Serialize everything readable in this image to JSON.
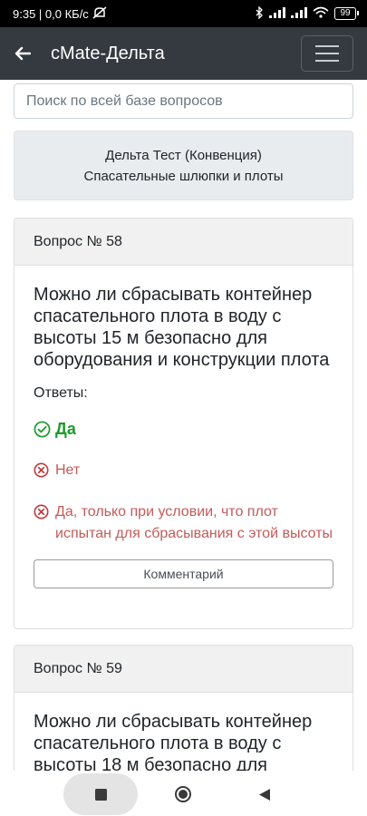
{
  "status_bar": {
    "time_speed": "9:35 | 0,0 КБ/с",
    "battery": "99"
  },
  "app_bar": {
    "title": "cMate-Дельта"
  },
  "search": {
    "placeholder": "Поиск по всей базе вопросов"
  },
  "topic": {
    "line1": "Дельта Тест (Конвенция)",
    "line2": "Спасательные шлюпки и плоты"
  },
  "questions": [
    {
      "header": "Вопрос № 58",
      "text": "Можно ли сбрасывать контейнер спасательного плота в воду с высоты 15 м безопасно для оборудования и конструкции плота",
      "answers_label": "Ответы:",
      "answers": [
        {
          "text": "Да",
          "status": "correct"
        },
        {
          "text": "Нет",
          "status": "wrong"
        },
        {
          "text": "Да, только при условии, что плот испытан для сбрасывания с этой высоты",
          "status": "wrong"
        }
      ],
      "comment_label": "Комментарий"
    },
    {
      "header": "Вопрос № 59",
      "text": "Можно ли сбрасывать контейнер спасательного плота в воду с высоты 18 м безопасно для"
    }
  ],
  "colors": {
    "appbar": "#343a40",
    "correct": "#1e9b2e",
    "wrong": "#c45a5a"
  },
  "icons": {
    "back": "arrow-left-icon",
    "menu": "hamburger-menu-icon",
    "correct": "check-circle-icon",
    "wrong": "x-circle-icon"
  }
}
